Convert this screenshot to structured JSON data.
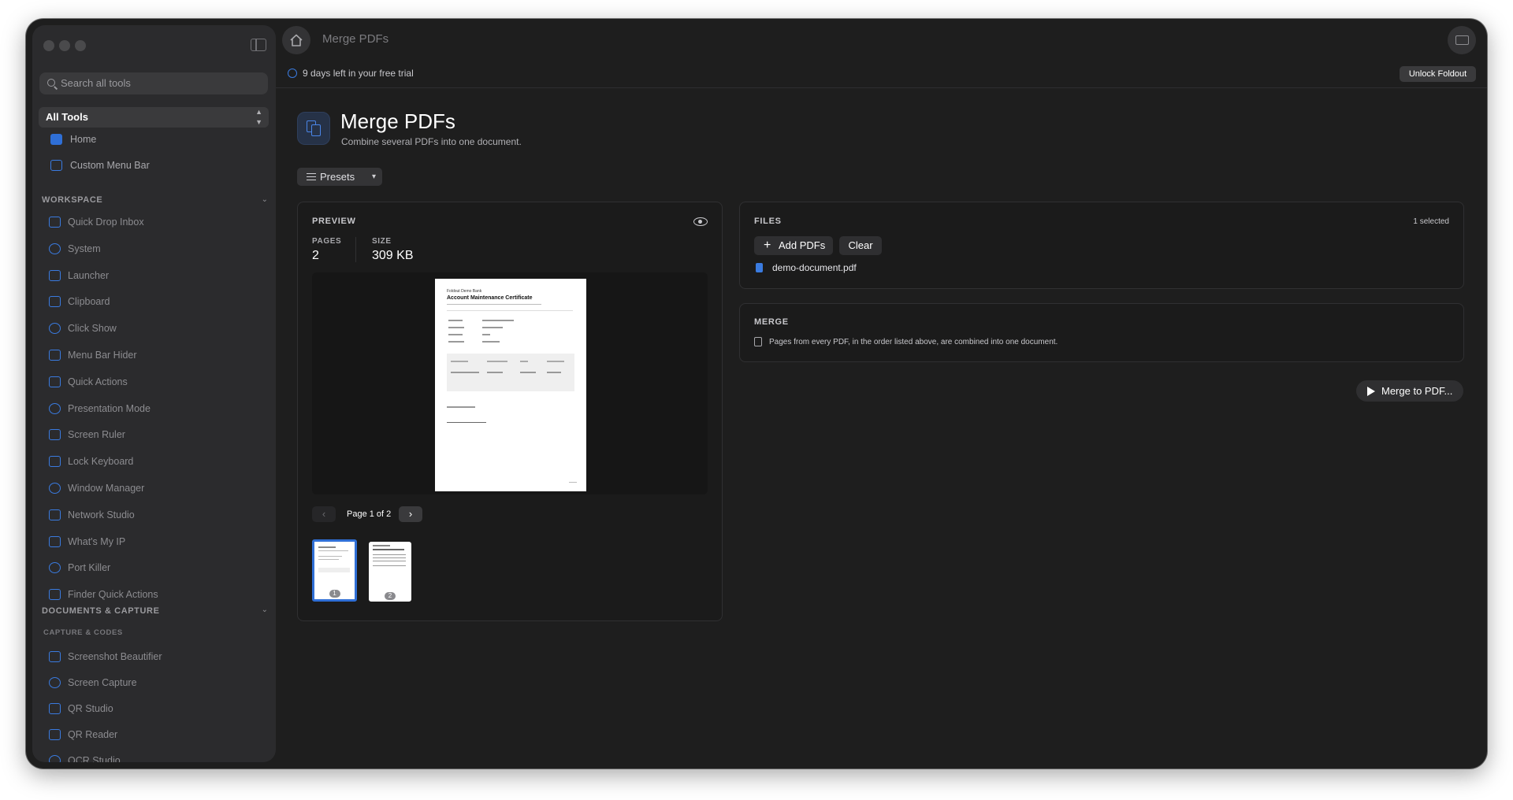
{
  "window": {
    "title": "Merge PDFs"
  },
  "sidebar": {
    "search_placeholder": "Search all tools",
    "scope": "All Tools",
    "top_items": [
      {
        "label": "Home",
        "icon": "home-icon"
      },
      {
        "label": "Custom Menu Bar",
        "icon": "menu-bar-icon"
      }
    ],
    "workspace": {
      "title": "WORKSPACE",
      "items": [
        {
          "label": "Quick Drop Inbox",
          "icon": "inbox-icon"
        },
        {
          "label": "System",
          "icon": "system-icon"
        },
        {
          "label": "Launcher",
          "icon": "command-icon"
        },
        {
          "label": "Clipboard",
          "icon": "clipboard-icon"
        },
        {
          "label": "Click Show",
          "icon": "click-icon"
        },
        {
          "label": "Menu Bar Hider",
          "icon": "menu-bar-hider-icon"
        },
        {
          "label": "Quick Actions",
          "icon": "quick-actions-icon"
        },
        {
          "label": "Presentation Mode",
          "icon": "presentation-icon"
        },
        {
          "label": "Screen Ruler",
          "icon": "ruler-icon"
        },
        {
          "label": "Lock Keyboard",
          "icon": "lock-icon"
        },
        {
          "label": "Window Manager",
          "icon": "window-icon"
        },
        {
          "label": "Network Studio",
          "icon": "network-icon"
        },
        {
          "label": "What's My IP",
          "icon": "globe-icon"
        },
        {
          "label": "Port Killer",
          "icon": "port-icon"
        },
        {
          "label": "Finder Quick Actions",
          "icon": "finder-icon"
        }
      ]
    },
    "documents": {
      "title": "DOCUMENTS & CAPTURE",
      "subtitle": "CAPTURE & CODES",
      "items": [
        {
          "label": "Screenshot Beautifier",
          "icon": "screenshot-icon"
        },
        {
          "label": "Screen Capture",
          "icon": "capture-icon"
        },
        {
          "label": "QR Studio",
          "icon": "qr-icon"
        },
        {
          "label": "QR Reader",
          "icon": "qr-reader-icon"
        },
        {
          "label": "OCR Studio",
          "icon": "ocr-icon"
        }
      ]
    }
  },
  "trial": {
    "text": "9 days left in your free trial",
    "unlock_label": "Unlock Foldout"
  },
  "page": {
    "title": "Merge PDFs",
    "subtitle": "Combine several PDFs into one document.",
    "presets_label": "Presets"
  },
  "preview": {
    "label": "PREVIEW",
    "pages_label": "PAGES",
    "pages_value": "2",
    "size_label": "SIZE",
    "size_value": "309 KB",
    "page_indicator": "Page 1 of 2",
    "thumbnails": [
      "1",
      "2"
    ],
    "document": {
      "bank": "Foldout Demo Bank",
      "title": "Account Maintenance Certificate"
    }
  },
  "files": {
    "label": "FILES",
    "selected_count": "1 selected",
    "add_label": "Add PDFs",
    "clear_label": "Clear",
    "items": [
      "demo-document.pdf"
    ]
  },
  "merge": {
    "label": "MERGE",
    "description": "Pages from every PDF, in the order listed above, are combined into one document.",
    "button_label": "Merge to PDF..."
  },
  "colors": {
    "accent": "#3a7be0",
    "background": "#1e1e1e",
    "sidebar": "#2b2b2d"
  }
}
